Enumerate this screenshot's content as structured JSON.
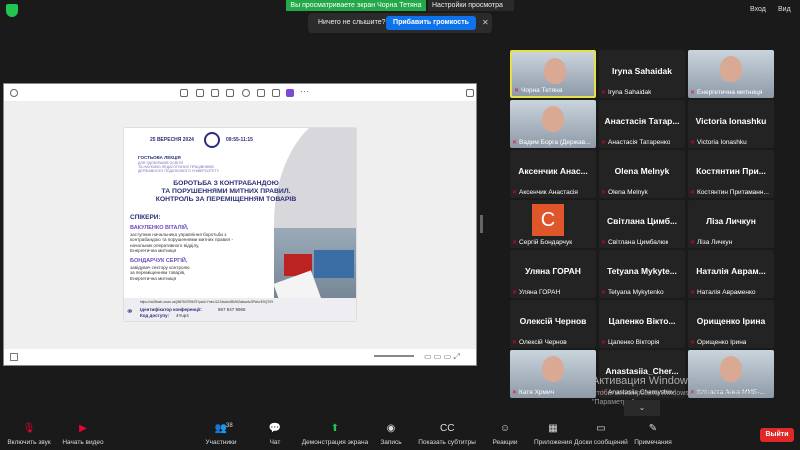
{
  "topbar": {
    "sharing_banner": "Вы просматриваете экран Чорна Тетяна",
    "view_options": "Настройки просмотра",
    "signin": "Вход",
    "view": "Вид"
  },
  "notice": {
    "text": "Ничего не слышите?",
    "button": "Прибавить громкость"
  },
  "slide": {
    "date": "25 ВЕРЕСНЯ 2024",
    "time": "09:55-11:15",
    "lecture_title": "ГОСТЬОВА ЛЕКЦІЯ",
    "lecture_sub": [
      "ДЛЯ ЗДОБУВАЧІВ ОСВІТИ",
      "ТА НАУКОВО-ПЕДАГОГІЧНИХ ПРАЦІВНИКІВ",
      "ДЕРЖАВНОГО ПОДАТКОВОГО УНІВЕРСИТЕТУ"
    ],
    "headline": [
      "БОРОТЬБА З КОНТРАБАНДОЮ",
      "ТА ПОРУШЕННЯМИ МИТНИХ ПРАВИЛ.",
      "КОНТРОЛЬ ЗА ПЕРЕМІЩЕННЯМ ТОВАРІВ"
    ],
    "speakers_label": "СПІКЕРИ:",
    "speaker1_name": "ВАКУЛЕНКО ВІТАЛІЙ,",
    "speaker1_role": [
      "заступник начальника управління боротьби з",
      "контрабандою та порушеннями митних правил -",
      "начальник оперативного відділу,",
      "Енергетична митниця"
    ],
    "speaker2_name": "БОНДАРЧУК СЕРГІЙ,",
    "speaker2_role": [
      "завідувач сектору контролю",
      "за переміщенням товарів,",
      "Енергетична митниця"
    ],
    "link": "https://us05web.zoom.us/j/86784799675?pwd=YmnU1ZJ4wdmJBMHZaksw4o3FWczESQT09",
    "conf_id_label": "Ідентифікатор конференції:",
    "conf_id": "867 847 9965",
    "code_label": "Код доступу:",
    "code": "4Yup4"
  },
  "participants": [
    {
      "name": "",
      "label": "Чорна Тетяна",
      "active": true,
      "video": true
    },
    {
      "name": "Iryna Sahaidak",
      "label": "Iryna Sahaidak"
    },
    {
      "name": "",
      "label": "Енергетична митниця",
      "video": true
    },
    {
      "name": "",
      "label": "Вадим Борга (Держав...",
      "video": true
    },
    {
      "name": "Анастасія Татар...",
      "label": "Анастасія Татаренко"
    },
    {
      "name": "Victoria Ionashku",
      "label": "Victoria Ionashku"
    },
    {
      "name": "Аксенчик Анас...",
      "label": "Аксенчик Анастасія"
    },
    {
      "name": "Olena Melnyk",
      "label": "Olena Melnyk"
    },
    {
      "name": "Костянтин При...",
      "label": "Костянтин Притаманн..."
    },
    {
      "name": "",
      "label": "Сергій Бондарчук",
      "avatar": "С"
    },
    {
      "name": "Світлана Цимб...",
      "label": "Світлана Цимбалюк"
    },
    {
      "name": "Ліза Личкун",
      "label": "Ліза Личкун"
    },
    {
      "name": "Уляна ГОРАН",
      "label": "Уляна ГОРАН"
    },
    {
      "name": "Tetyana Mykyte...",
      "label": "Tetyana Mykytenko"
    },
    {
      "name": "Наталія Аврам...",
      "label": "Наталія Авраменко"
    },
    {
      "name": "Олексій Чернов",
      "label": "Олексій Чернов"
    },
    {
      "name": "Цапенко Вікто...",
      "label": "Цапенко Вікторія"
    },
    {
      "name": "Орищенко Ірина",
      "label": "Орищенко Ірина"
    },
    {
      "name": "",
      "label": "Катя Хрмич",
      "video": true
    },
    {
      "name": "Anastasiia_Cher...",
      "label": "Anastasiia Chernyshov"
    },
    {
      "name": "",
      "label": "Клічаєва Анна ММБ-...",
      "video": true
    }
  ],
  "watermark": {
    "line1": "Активация Windows",
    "line2": "Чтобы активировать Windows, перейдите в раздел",
    "line3": "\"Параметры\"."
  },
  "toolbar": [
    {
      "label": "Включить звук",
      "glyph": "🎙"
    },
    {
      "label": "Начать видео",
      "glyph": "▶"
    },
    {
      "label": "Участники",
      "glyph": "👥",
      "count": "38"
    },
    {
      "label": "Чат",
      "glyph": "💬"
    },
    {
      "label": "Демонстрация экрана",
      "glyph": "⬆"
    },
    {
      "label": "Запись",
      "glyph": "◉"
    },
    {
      "label": "Показать субтитры",
      "glyph": "CC"
    },
    {
      "label": "Реакции",
      "glyph": "☺"
    },
    {
      "label": "Приложения",
      "glyph": "▦"
    },
    {
      "label": "Доски сообщений",
      "glyph": "▭"
    },
    {
      "label": "Примечания",
      "glyph": "✎"
    }
  ],
  "leave": "Выйти"
}
